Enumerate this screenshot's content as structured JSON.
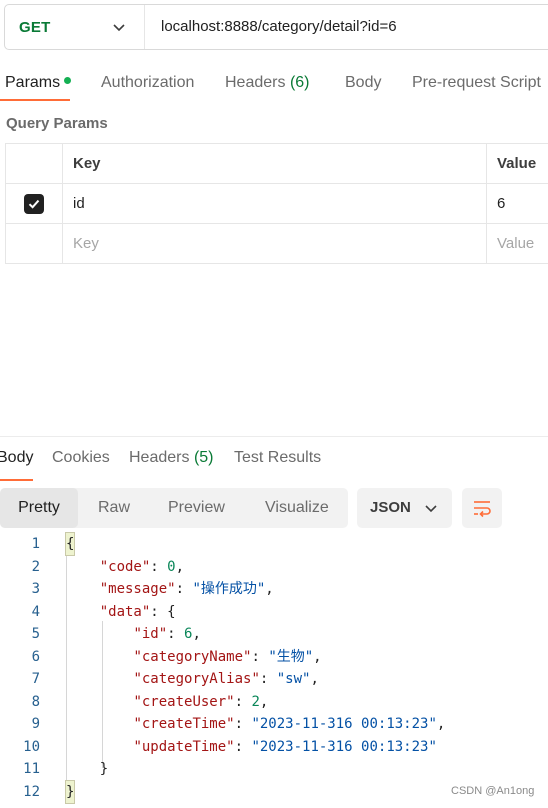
{
  "request": {
    "method": "GET",
    "url": "localhost:8888/category/detail?id=6"
  },
  "request_tabs": [
    {
      "label": "Params",
      "active": true,
      "dot": true
    },
    {
      "label": "Authorization"
    },
    {
      "label": "Headers",
      "count": "(6)"
    },
    {
      "label": "Body"
    },
    {
      "label": "Pre-request Script"
    }
  ],
  "params": {
    "title": "Query Params",
    "columns": [
      "Key",
      "Value"
    ],
    "rows": [
      {
        "checked": true,
        "key": "id",
        "value": "6"
      }
    ],
    "placeholder": {
      "key": "Key",
      "value": "Value"
    }
  },
  "response_tabs": [
    {
      "label": "Body",
      "active": true
    },
    {
      "label": "Cookies"
    },
    {
      "label": "Headers",
      "count": "(5)"
    },
    {
      "label": "Test Results"
    }
  ],
  "view_modes": [
    "Pretty",
    "Raw",
    "Preview",
    "Visualize"
  ],
  "format": "JSON",
  "code_lines": [
    {
      "n": "1",
      "text": "{"
    },
    {
      "n": "2",
      "text": "    \"code\": 0,"
    },
    {
      "n": "3",
      "text": "    \"message\": \"操作成功\","
    },
    {
      "n": "4",
      "text": "    \"data\": {"
    },
    {
      "n": "5",
      "text": "        \"id\": 6,"
    },
    {
      "n": "6",
      "text": "        \"categoryName\": \"生物\","
    },
    {
      "n": "7",
      "text": "        \"categoryAlias\": \"sw\","
    },
    {
      "n": "8",
      "text": "        \"createUser\": 2,"
    },
    {
      "n": "9",
      "text": "        \"createTime\": \"2023-11-316 00:13:23\","
    },
    {
      "n": "10",
      "text": "        \"updateTime\": \"2023-11-316 00:13:23\""
    },
    {
      "n": "11",
      "text": "    }"
    },
    {
      "n": "12",
      "text": "}"
    }
  ],
  "watermark": "CSDN @An1ong",
  "colors": {
    "method_get": "#0a7a36",
    "accent": "#ff6c37",
    "json_key": "#a31515",
    "json_string": "#0451a5",
    "json_number": "#098658"
  }
}
